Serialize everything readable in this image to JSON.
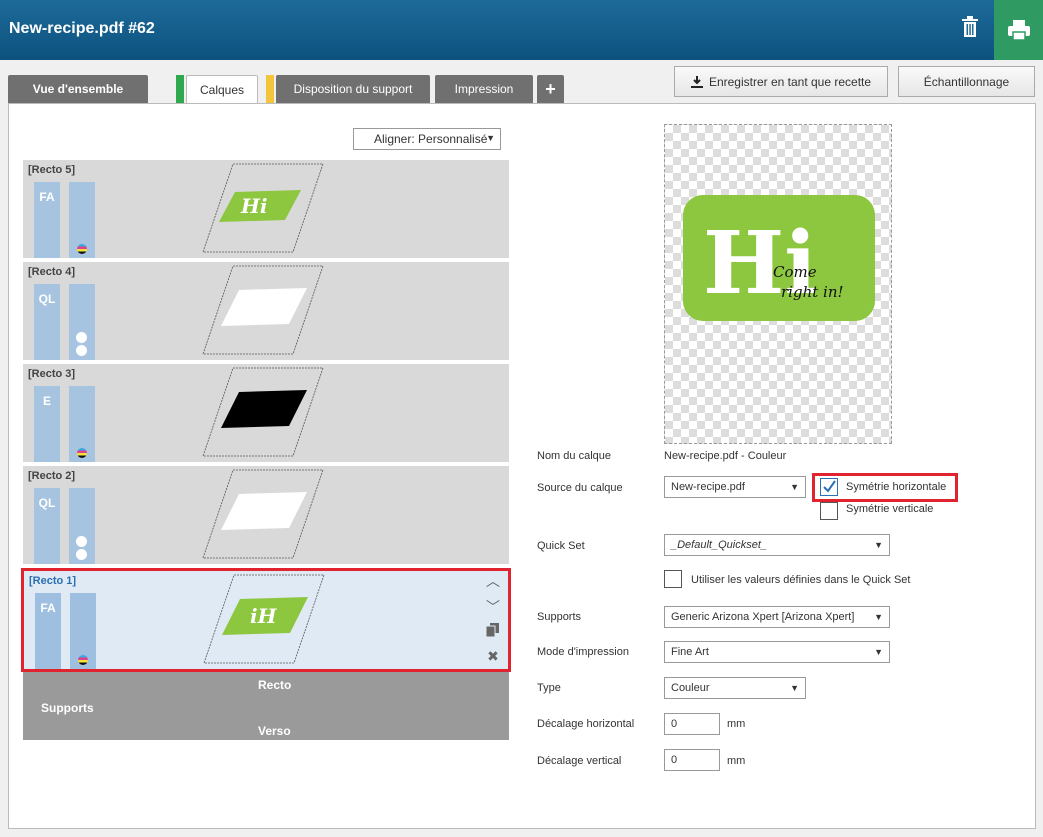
{
  "window": {
    "title": "New-recipe.pdf #62"
  },
  "tabs": {
    "overview": "Vue d'ensemble",
    "layers": "Calques",
    "media_layout": "Disposition du support",
    "print": "Impression",
    "add": "+"
  },
  "toolbar": {
    "save_recipe": "Enregistrer en tant que recette",
    "sampling": "Échantillonnage"
  },
  "align": {
    "value": "Aligner: Personnalisé"
  },
  "layers": [
    {
      "name": "[Recto 5]",
      "mode": "FA",
      "ink": "cmyk"
    },
    {
      "name": "[Recto 4]",
      "mode": "QL",
      "ink": "white"
    },
    {
      "name": "[Recto 3]",
      "mode": "E",
      "ink": "cmyk"
    },
    {
      "name": "[Recto 2]",
      "mode": "QL",
      "ink": "white"
    },
    {
      "name": "[Recto 1]",
      "mode": "FA",
      "ink": "cmyk",
      "selected": true
    }
  ],
  "supports_band": {
    "label": "Supports",
    "recto": "Recto",
    "verso": "Verso"
  },
  "preview": {
    "big_text": "Hi",
    "script_line1": "Come",
    "script_line2": "right in!",
    "accent": "#8dc63f"
  },
  "form": {
    "layer_name_label": "Nom du calque",
    "layer_name_value": "New-recipe.pdf - Couleur",
    "layer_source_label": "Source du calque",
    "layer_source_value": "New-recipe.pdf",
    "mirror_h": "Symétrie horizontale",
    "mirror_v": "Symétrie verticale",
    "quickset_label": "Quick Set",
    "quickset_value": "_Default_Quickset_",
    "use_quickset": "Utiliser les valeurs définies dans le Quick Set",
    "supports_label": "Supports",
    "supports_value": "Generic Arizona Xpert [Arizona Xpert]",
    "print_mode_label": "Mode d'impression",
    "print_mode_value": "Fine Art",
    "type_label": "Type",
    "type_value": "Couleur",
    "h_offset_label": "Décalage horizontal",
    "h_offset_value": "0",
    "v_offset_label": "Décalage vertical",
    "v_offset_value": "0",
    "unit": "mm"
  },
  "colors": {
    "header": "#0d527f",
    "print_btn": "#2f9b63",
    "highlight": "#e0232f",
    "tab_green": "#2fa84f",
    "tab_yellow": "#f3c53b"
  }
}
